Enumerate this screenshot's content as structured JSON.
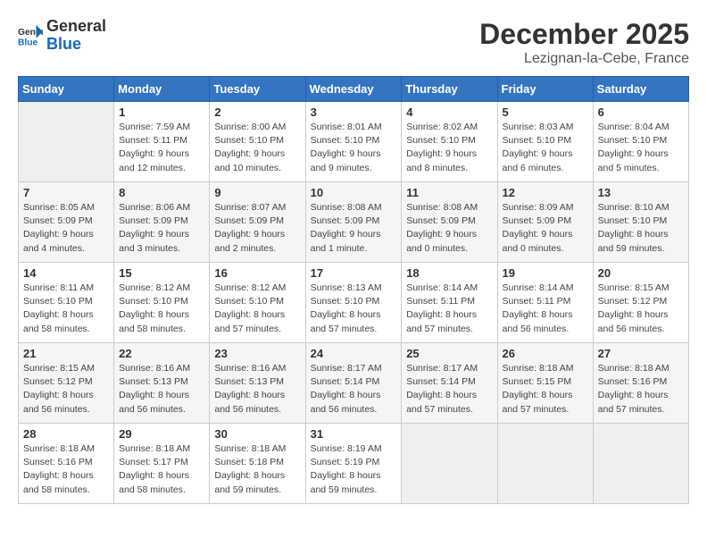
{
  "header": {
    "logo_general": "General",
    "logo_blue": "Blue",
    "month": "December 2025",
    "location": "Lezignan-la-Cebe, France"
  },
  "days_of_week": [
    "Sunday",
    "Monday",
    "Tuesday",
    "Wednesday",
    "Thursday",
    "Friday",
    "Saturday"
  ],
  "weeks": [
    [
      {
        "day": "",
        "sunrise": "",
        "sunset": "",
        "daylight": ""
      },
      {
        "day": "1",
        "sunrise": "Sunrise: 7:59 AM",
        "sunset": "Sunset: 5:11 PM",
        "daylight": "Daylight: 9 hours and 12 minutes."
      },
      {
        "day": "2",
        "sunrise": "Sunrise: 8:00 AM",
        "sunset": "Sunset: 5:10 PM",
        "daylight": "Daylight: 9 hours and 10 minutes."
      },
      {
        "day": "3",
        "sunrise": "Sunrise: 8:01 AM",
        "sunset": "Sunset: 5:10 PM",
        "daylight": "Daylight: 9 hours and 9 minutes."
      },
      {
        "day": "4",
        "sunrise": "Sunrise: 8:02 AM",
        "sunset": "Sunset: 5:10 PM",
        "daylight": "Daylight: 9 hours and 8 minutes."
      },
      {
        "day": "5",
        "sunrise": "Sunrise: 8:03 AM",
        "sunset": "Sunset: 5:10 PM",
        "daylight": "Daylight: 9 hours and 6 minutes."
      },
      {
        "day": "6",
        "sunrise": "Sunrise: 8:04 AM",
        "sunset": "Sunset: 5:10 PM",
        "daylight": "Daylight: 9 hours and 5 minutes."
      }
    ],
    [
      {
        "day": "7",
        "sunrise": "Sunrise: 8:05 AM",
        "sunset": "Sunset: 5:09 PM",
        "daylight": "Daylight: 9 hours and 4 minutes."
      },
      {
        "day": "8",
        "sunrise": "Sunrise: 8:06 AM",
        "sunset": "Sunset: 5:09 PM",
        "daylight": "Daylight: 9 hours and 3 minutes."
      },
      {
        "day": "9",
        "sunrise": "Sunrise: 8:07 AM",
        "sunset": "Sunset: 5:09 PM",
        "daylight": "Daylight: 9 hours and 2 minutes."
      },
      {
        "day": "10",
        "sunrise": "Sunrise: 8:08 AM",
        "sunset": "Sunset: 5:09 PM",
        "daylight": "Daylight: 9 hours and 1 minute."
      },
      {
        "day": "11",
        "sunrise": "Sunrise: 8:08 AM",
        "sunset": "Sunset: 5:09 PM",
        "daylight": "Daylight: 9 hours and 0 minutes."
      },
      {
        "day": "12",
        "sunrise": "Sunrise: 8:09 AM",
        "sunset": "Sunset: 5:09 PM",
        "daylight": "Daylight: 9 hours and 0 minutes."
      },
      {
        "day": "13",
        "sunrise": "Sunrise: 8:10 AM",
        "sunset": "Sunset: 5:10 PM",
        "daylight": "Daylight: 8 hours and 59 minutes."
      }
    ],
    [
      {
        "day": "14",
        "sunrise": "Sunrise: 8:11 AM",
        "sunset": "Sunset: 5:10 PM",
        "daylight": "Daylight: 8 hours and 58 minutes."
      },
      {
        "day": "15",
        "sunrise": "Sunrise: 8:12 AM",
        "sunset": "Sunset: 5:10 PM",
        "daylight": "Daylight: 8 hours and 58 minutes."
      },
      {
        "day": "16",
        "sunrise": "Sunrise: 8:12 AM",
        "sunset": "Sunset: 5:10 PM",
        "daylight": "Daylight: 8 hours and 57 minutes."
      },
      {
        "day": "17",
        "sunrise": "Sunrise: 8:13 AM",
        "sunset": "Sunset: 5:10 PM",
        "daylight": "Daylight: 8 hours and 57 minutes."
      },
      {
        "day": "18",
        "sunrise": "Sunrise: 8:14 AM",
        "sunset": "Sunset: 5:11 PM",
        "daylight": "Daylight: 8 hours and 57 minutes."
      },
      {
        "day": "19",
        "sunrise": "Sunrise: 8:14 AM",
        "sunset": "Sunset: 5:11 PM",
        "daylight": "Daylight: 8 hours and 56 minutes."
      },
      {
        "day": "20",
        "sunrise": "Sunrise: 8:15 AM",
        "sunset": "Sunset: 5:12 PM",
        "daylight": "Daylight: 8 hours and 56 minutes."
      }
    ],
    [
      {
        "day": "21",
        "sunrise": "Sunrise: 8:15 AM",
        "sunset": "Sunset: 5:12 PM",
        "daylight": "Daylight: 8 hours and 56 minutes."
      },
      {
        "day": "22",
        "sunrise": "Sunrise: 8:16 AM",
        "sunset": "Sunset: 5:13 PM",
        "daylight": "Daylight: 8 hours and 56 minutes."
      },
      {
        "day": "23",
        "sunrise": "Sunrise: 8:16 AM",
        "sunset": "Sunset: 5:13 PM",
        "daylight": "Daylight: 8 hours and 56 minutes."
      },
      {
        "day": "24",
        "sunrise": "Sunrise: 8:17 AM",
        "sunset": "Sunset: 5:14 PM",
        "daylight": "Daylight: 8 hours and 56 minutes."
      },
      {
        "day": "25",
        "sunrise": "Sunrise: 8:17 AM",
        "sunset": "Sunset: 5:14 PM",
        "daylight": "Daylight: 8 hours and 57 minutes."
      },
      {
        "day": "26",
        "sunrise": "Sunrise: 8:18 AM",
        "sunset": "Sunset: 5:15 PM",
        "daylight": "Daylight: 8 hours and 57 minutes."
      },
      {
        "day": "27",
        "sunrise": "Sunrise: 8:18 AM",
        "sunset": "Sunset: 5:16 PM",
        "daylight": "Daylight: 8 hours and 57 minutes."
      }
    ],
    [
      {
        "day": "28",
        "sunrise": "Sunrise: 8:18 AM",
        "sunset": "Sunset: 5:16 PM",
        "daylight": "Daylight: 8 hours and 58 minutes."
      },
      {
        "day": "29",
        "sunrise": "Sunrise: 8:18 AM",
        "sunset": "Sunset: 5:17 PM",
        "daylight": "Daylight: 8 hours and 58 minutes."
      },
      {
        "day": "30",
        "sunrise": "Sunrise: 8:18 AM",
        "sunset": "Sunset: 5:18 PM",
        "daylight": "Daylight: 8 hours and 59 minutes."
      },
      {
        "day": "31",
        "sunrise": "Sunrise: 8:19 AM",
        "sunset": "Sunset: 5:19 PM",
        "daylight": "Daylight: 8 hours and 59 minutes."
      },
      {
        "day": "",
        "sunrise": "",
        "sunset": "",
        "daylight": ""
      },
      {
        "day": "",
        "sunrise": "",
        "sunset": "",
        "daylight": ""
      },
      {
        "day": "",
        "sunrise": "",
        "sunset": "",
        "daylight": ""
      }
    ]
  ]
}
